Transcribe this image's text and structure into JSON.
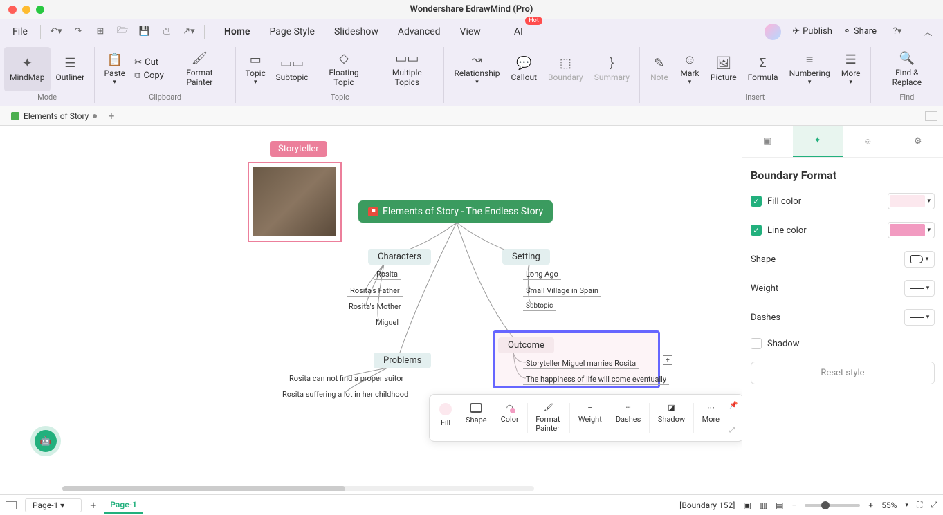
{
  "window": {
    "title": "Wondershare EdrawMind (Pro)"
  },
  "menubar": {
    "file": "File",
    "tabs": [
      "Home",
      "Page Style",
      "Slideshow",
      "Advanced",
      "View",
      "AI"
    ],
    "active_tab": "Home",
    "ai_badge": "Hot",
    "publish": "Publish",
    "share": "Share"
  },
  "ribbon": {
    "mode": {
      "mindmap": "MindMap",
      "outliner": "Outliner",
      "label": "Mode"
    },
    "clipboard": {
      "paste": "Paste",
      "cut": "Cut",
      "copy": "Copy",
      "format_painter": "Format Painter",
      "label": "Clipboard"
    },
    "topic": {
      "topic": "Topic",
      "subtopic": "Subtopic",
      "floating": "Floating Topic",
      "multiple": "Multiple Topics",
      "label": "Topic"
    },
    "rel": {
      "relationship": "Relationship",
      "callout": "Callout",
      "boundary": "Boundary",
      "summary": "Summary"
    },
    "insert": {
      "note": "Note",
      "mark": "Mark",
      "picture": "Picture",
      "formula": "Formula",
      "numbering": "Numbering",
      "more": "More",
      "label": "Insert"
    },
    "find": {
      "find_replace": "Find & Replace",
      "label": "Find"
    }
  },
  "doc_tab": {
    "name": "Elements of Story"
  },
  "mindmap": {
    "floating_label": "Storyteller",
    "central": "Elements of Story - The Endless Story",
    "branches": {
      "characters": {
        "title": "Characters",
        "items": [
          "Rosita",
          "Rosita's Father",
          "Rosita's Mother",
          "Miguel"
        ]
      },
      "setting": {
        "title": "Setting",
        "items": [
          "Long Ago",
          "Small Village in Spain",
          "Subtopic"
        ]
      },
      "problems": {
        "title": "Problems",
        "items": [
          "Rosita can not find a proper suitor",
          "Rosita suffering a lot in her childhood"
        ]
      },
      "outcome": {
        "title": "Outcome",
        "items": [
          "Storyteller Miguel marries Rosita",
          "The happiness of life will come eventually"
        ]
      }
    }
  },
  "float_toolbar": {
    "fill": "Fill",
    "shape": "Shape",
    "color": "Color",
    "format_painter": "Format Painter",
    "weight": "Weight",
    "dashes": "Dashes",
    "shadow": "Shadow",
    "more": "More"
  },
  "side_panel": {
    "title": "Boundary Format",
    "fill_color": "Fill color",
    "line_color": "Line color",
    "shape": "Shape",
    "weight": "Weight",
    "dashes": "Dashes",
    "shadow": "Shadow",
    "reset": "Reset style",
    "fill_hex": "#fce8ee",
    "line_hex": "#f29bc1"
  },
  "status": {
    "page_sel": "Page-1",
    "page_tab": "Page-1",
    "selection": "[Boundary 152]",
    "zoom": "55%"
  }
}
